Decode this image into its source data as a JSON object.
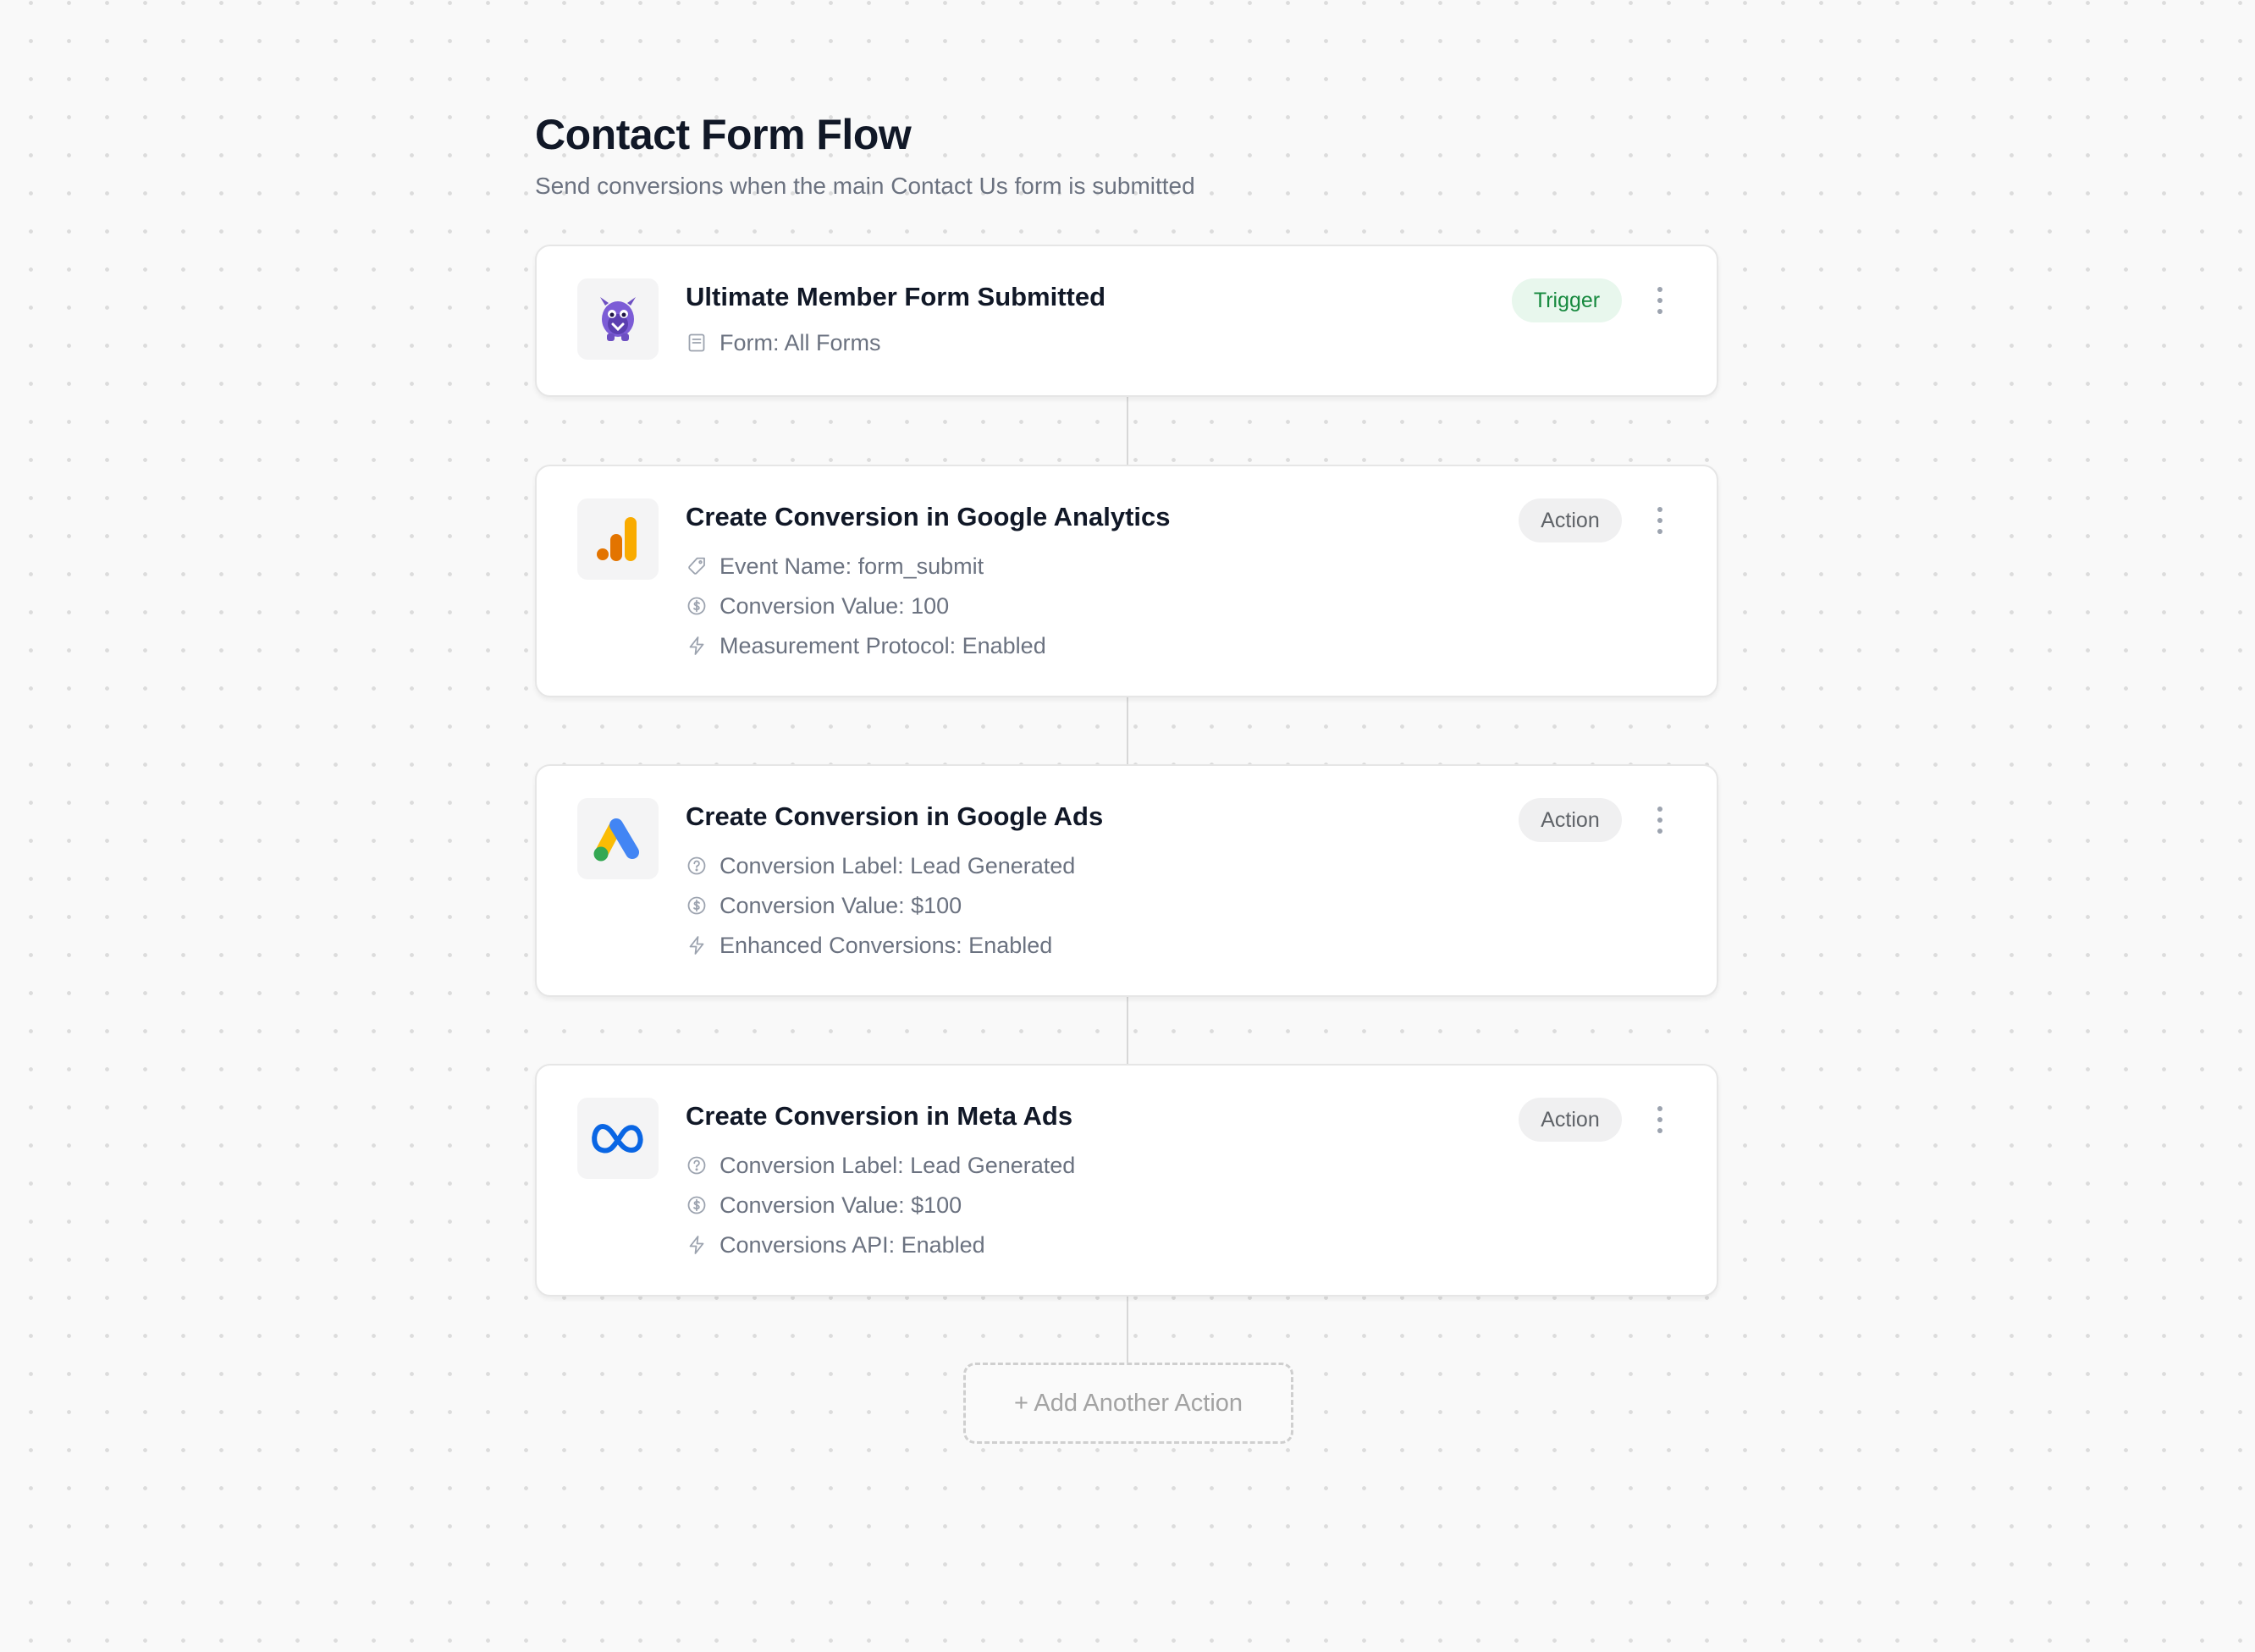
{
  "flow": {
    "title": "Contact Form Flow",
    "subtitle": "Send conversions when the main Contact Us form is submitted"
  },
  "steps": [
    {
      "title": "Ultimate Member Form Submitted",
      "badge": "Trigger",
      "icon": "ultimate-member-icon",
      "details": [
        {
          "icon": "form-icon",
          "text": "Form: All Forms"
        }
      ]
    },
    {
      "title": "Create Conversion in Google Analytics",
      "badge": "Action",
      "icon": "google-analytics-icon",
      "details": [
        {
          "icon": "tag-icon",
          "text": "Event Name: form_submit"
        },
        {
          "icon": "dollar-icon",
          "text": "Conversion Value: 100"
        },
        {
          "icon": "bolt-icon",
          "text": "Measurement Protocol: Enabled"
        }
      ]
    },
    {
      "title": "Create Conversion in Google Ads",
      "badge": "Action",
      "icon": "google-ads-icon",
      "details": [
        {
          "icon": "help-circle-icon",
          "text": "Conversion Label: Lead Generated"
        },
        {
          "icon": "dollar-icon",
          "text": "Conversion Value: $100"
        },
        {
          "icon": "bolt-icon",
          "text": "Enhanced Conversions: Enabled"
        }
      ]
    },
    {
      "title": "Create Conversion in Meta Ads",
      "badge": "Action",
      "icon": "meta-icon",
      "details": [
        {
          "icon": "help-circle-icon",
          "text": "Conversion Label: Lead Generated"
        },
        {
          "icon": "dollar-icon",
          "text": "Conversion Value: $100"
        },
        {
          "icon": "bolt-icon",
          "text": "Conversions API: Enabled"
        }
      ]
    }
  ],
  "add_action_label": "+ Add Another Action",
  "colors": {
    "trigger_badge_bg": "#e8f7ed",
    "trigger_badge_text": "#16893e",
    "action_badge_bg": "#f0f0f1",
    "action_badge_text": "#5f6368",
    "meta_blue": "#0a66e4",
    "ga_orange": "#f9ab00",
    "ga_dark_orange": "#e37400"
  }
}
